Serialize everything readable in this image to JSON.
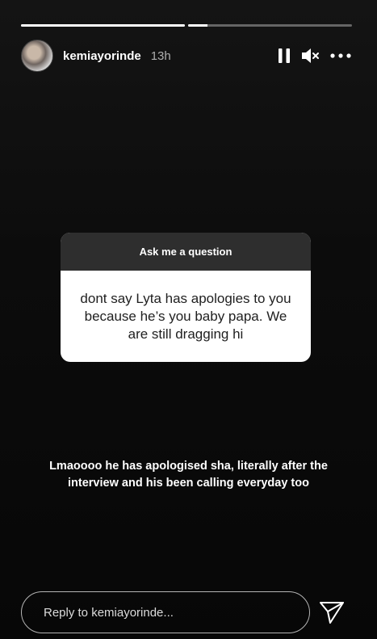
{
  "story": {
    "progress": [
      1,
      0.12
    ],
    "user": {
      "username": "kemiayorinde",
      "time": "13h"
    },
    "controls": {
      "pause_icon": "pause-icon",
      "mute_icon": "muted-speaker-icon",
      "more_icon": "more-horizontal-icon"
    }
  },
  "question_sticker": {
    "title": "Ask me a question",
    "question": "dont say Lyta has apologies to you because he’s you baby papa. We are still dragging hi"
  },
  "reply_caption": "Lmaoooo he has apologised sha, literally after the interview and his been calling everyday too",
  "footer": {
    "reply_placeholder": "Reply to kemiayorinde...",
    "send_icon": "paper-plane-icon"
  }
}
